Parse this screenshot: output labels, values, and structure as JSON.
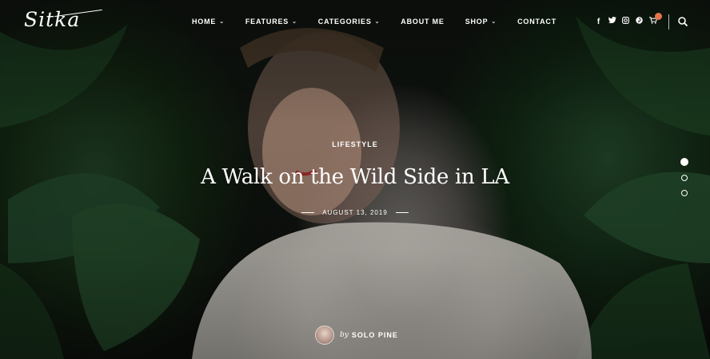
{
  "site": {
    "logo": "Sitka"
  },
  "nav": {
    "items": [
      {
        "label": "HOME",
        "dropdown": true
      },
      {
        "label": "FEATURES",
        "dropdown": true
      },
      {
        "label": "CATEGORIES",
        "dropdown": true
      },
      {
        "label": "ABOUT ME",
        "dropdown": false
      },
      {
        "label": "SHOP",
        "dropdown": true
      },
      {
        "label": "CONTACT",
        "dropdown": false
      }
    ],
    "social_icons": [
      "facebook-icon",
      "twitter-icon",
      "instagram-icon",
      "pinterest-icon"
    ],
    "cart_icon": "cart-icon",
    "search_icon": "search-icon"
  },
  "hero": {
    "category": "LIFESTYLE",
    "title": "A Walk on the Wild Side in LA",
    "date": "AUGUST 13, 2019",
    "author_prefix": "by",
    "author_name": "SOLO PINE"
  },
  "slider": {
    "active_index": 0,
    "count": 3
  },
  "colors": {
    "text": "#ffffff",
    "cart_badge": "#e8734c"
  }
}
